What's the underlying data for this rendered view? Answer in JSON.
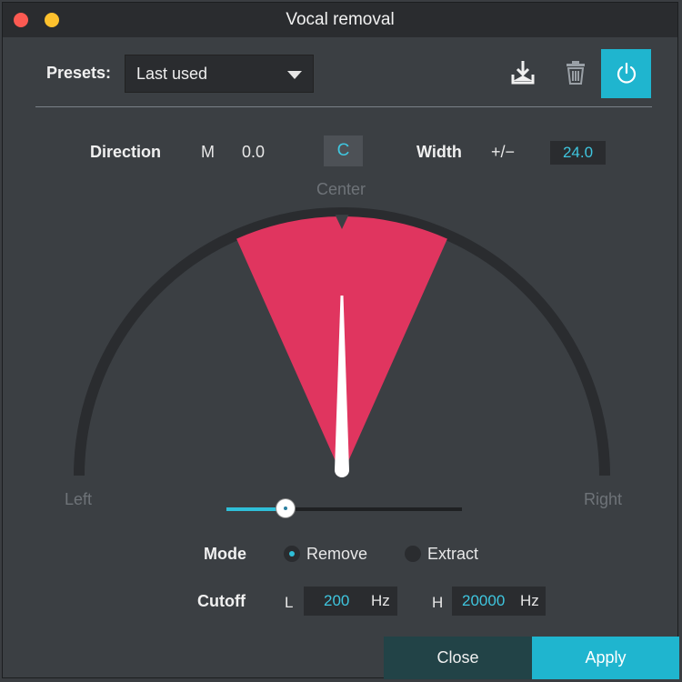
{
  "window": {
    "title": "Vocal removal"
  },
  "presets": {
    "label": "Presets:",
    "selected": "Last used"
  },
  "toolbar": {
    "download_icon": "download-icon",
    "trash_icon": "trash-icon",
    "power_icon": "power-icon"
  },
  "direction": {
    "label": "Direction",
    "m_label": "M",
    "value": "0.0",
    "center_button": "C"
  },
  "width": {
    "label": "Width",
    "sign": "+/−",
    "value": "24.0"
  },
  "dial": {
    "top_label": "Center",
    "left_label": "Left",
    "right_label": "Right",
    "direction_deg": 0,
    "width_deg": 24
  },
  "slider": {
    "value_fraction": 0.26
  },
  "mode": {
    "label": "Mode",
    "options": [
      {
        "label": "Remove",
        "selected": true
      },
      {
        "label": "Extract",
        "selected": false
      }
    ]
  },
  "cutoff": {
    "label": "Cutoff",
    "low": {
      "prefix": "L",
      "value": "200",
      "unit": "Hz"
    },
    "high": {
      "prefix": "H",
      "value": "20000",
      "unit": "Hz"
    }
  },
  "buttons": {
    "close": "Close",
    "apply": "Apply"
  },
  "colors": {
    "accent": "#1fb5cf",
    "sector": "#e0355f",
    "track": "#2a2c2f"
  }
}
